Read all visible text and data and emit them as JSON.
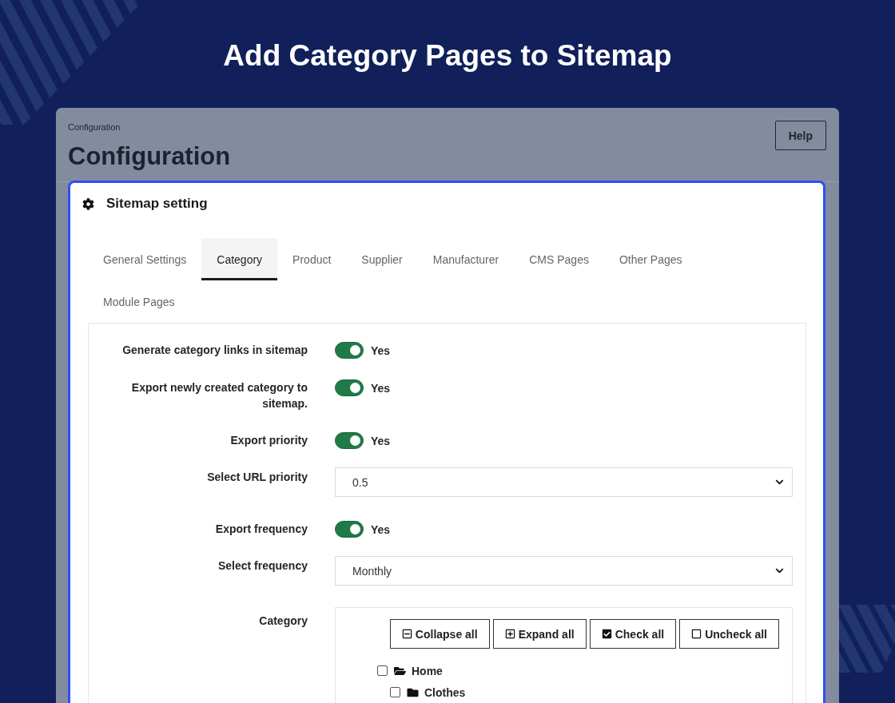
{
  "heading": "Add Category Pages to Sitemap",
  "page": {
    "breadcrumb": "Configuration",
    "title": "Configuration",
    "help_button": "Help"
  },
  "panel": {
    "title": "Sitemap setting",
    "tabs": [
      {
        "label": "General Settings",
        "selected": false
      },
      {
        "label": "Category",
        "selected": true
      },
      {
        "label": "Product",
        "selected": false
      },
      {
        "label": "Supplier",
        "selected": false
      },
      {
        "label": "Manufacturer",
        "selected": false
      },
      {
        "label": "CMS Pages",
        "selected": false
      },
      {
        "label": "Other Pages",
        "selected": false
      },
      {
        "label": "Module Pages",
        "selected": false
      }
    ],
    "form": [
      {
        "kind": "toggle",
        "label": "Generate category links in sitemap",
        "on": true,
        "value": "Yes"
      },
      {
        "kind": "toggle",
        "label": "Export newly created category to sitemap.",
        "on": true,
        "value": "Yes"
      },
      {
        "kind": "toggle",
        "label": "Export priority",
        "on": true,
        "value": "Yes"
      },
      {
        "kind": "select",
        "label": "Select URL priority",
        "value": "0.5"
      },
      {
        "kind": "toggle",
        "label": "Export frequency",
        "on": true,
        "value": "Yes"
      },
      {
        "kind": "select",
        "label": "Select frequency",
        "value": "Monthly"
      },
      {
        "kind": "tree",
        "label": "Category",
        "buttons": [
          {
            "kind": "collapse",
            "label": "Collapse all"
          },
          {
            "kind": "expand",
            "label": "Expand all"
          },
          {
            "kind": "check",
            "label": "Check all"
          },
          {
            "kind": "uncheck",
            "label": "Uncheck all"
          }
        ],
        "items": [
          {
            "label": "Home",
            "checked": false,
            "expanded": true,
            "children": [
              {
                "label": "Clothes",
                "checked": false,
                "expanded": false
              }
            ]
          }
        ]
      }
    ]
  }
}
